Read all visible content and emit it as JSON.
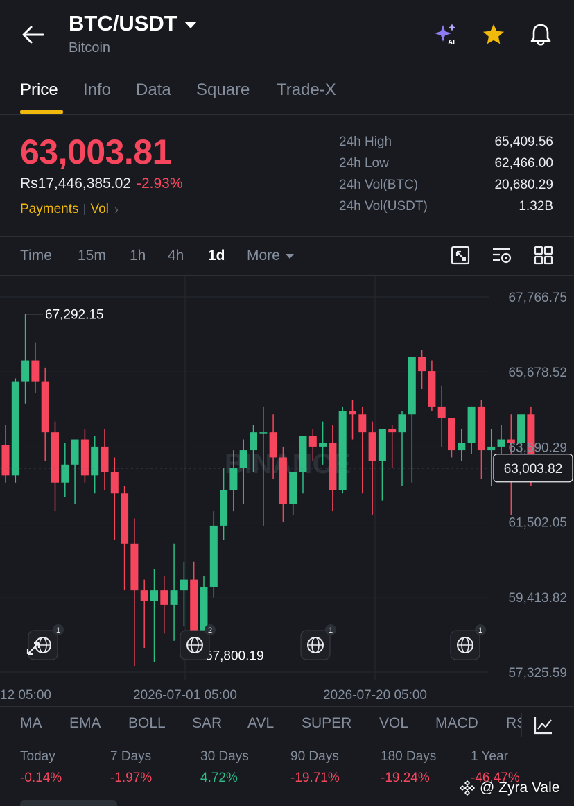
{
  "header": {
    "pair": "BTC/USDT",
    "name": "Bitcoin"
  },
  "tabs": [
    "Price",
    "Info",
    "Data",
    "Square",
    "Trade-X"
  ],
  "active_tab": "Price",
  "price": {
    "last": "63,003.81",
    "local": "Rs17,446,385.02",
    "change": "-2.93%",
    "tag_payments": "Payments",
    "tag_vol": "Vol"
  },
  "stats": [
    {
      "label": "24h High",
      "value": "65,409.56"
    },
    {
      "label": "24h Low",
      "value": "62,466.00"
    },
    {
      "label": "24h Vol(BTC)",
      "value": "20,680.29"
    },
    {
      "label": "24h Vol(USDT)",
      "value": "1.32B"
    }
  ],
  "timeframes": [
    "Time",
    "15m",
    "1h",
    "4h",
    "1d"
  ],
  "active_timeframe": "1d",
  "more_label": "More",
  "indicators": [
    "MA",
    "EMA",
    "BOLL",
    "SAR",
    "AVL",
    "SUPER",
    "VOL",
    "MACD",
    "RSI"
  ],
  "performance": [
    {
      "label": "Today",
      "value": "-0.14%"
    },
    {
      "label": "7 Days",
      "value": "-1.97%"
    },
    {
      "label": "30 Days",
      "value": "4.72%"
    },
    {
      "label": "90 Days",
      "value": "-19.71%"
    },
    {
      "label": "180 Days",
      "value": "-19.24%"
    },
    {
      "label": "1 Year",
      "value": "-46.47%"
    }
  ],
  "watermark": "@ Zyra Vale",
  "colors": {
    "up": "#2ebd85",
    "down": "#f6465d",
    "accent": "#f0b90b",
    "bg": "#181a20"
  },
  "chart_data": {
    "type": "candlestick",
    "watermark": "BINANCE",
    "y_ticks": [
      "67,766.75",
      "65,678.52",
      "63,590.29",
      "61,502.05",
      "59,413.82",
      "57,325.59"
    ],
    "x_ticks": [
      "12 05:00",
      "2026-07-01 05:00",
      "2026-07-20 05:00"
    ],
    "ylim": [
      57325.59,
      67766.75
    ],
    "current_price": "63,003.82",
    "high_marker": "67,292.15",
    "low_marker": "57,800.19",
    "event_badges": [
      "1",
      "2",
      "1",
      "1"
    ],
    "candles": [
      [
        63650,
        64200,
        62600,
        62800
      ],
      [
        62800,
        65500,
        62600,
        65400
      ],
      [
        65400,
        67300,
        64800,
        66000
      ],
      [
        66000,
        66500,
        65100,
        65400
      ],
      [
        65400,
        65800,
        63200,
        64000
      ],
      [
        64000,
        64300,
        61800,
        62600
      ],
      [
        62600,
        63700,
        62200,
        63100
      ],
      [
        63100,
        63600,
        62000,
        63800
      ],
      [
        63800,
        64100,
        62600,
        62800
      ],
      [
        62800,
        63900,
        62300,
        63600
      ],
      [
        63600,
        64100,
        62400,
        62900
      ],
      [
        62900,
        63300,
        61000,
        62300
      ],
      [
        62300,
        62500,
        59600,
        60900
      ],
      [
        60900,
        61600,
        57500,
        59600
      ],
      [
        59600,
        59900,
        58000,
        59300
      ],
      [
        59300,
        60200,
        57600,
        59600
      ],
      [
        59600,
        60000,
        58400,
        59200
      ],
      [
        59200,
        60900,
        58200,
        59600
      ],
      [
        59600,
        60400,
        58600,
        59900
      ],
      [
        59900,
        60400,
        57800,
        58300
      ],
      [
        58300,
        60000,
        57900,
        59700
      ],
      [
        59700,
        61800,
        59400,
        61400
      ],
      [
        61400,
        63000,
        61000,
        62400
      ],
      [
        62400,
        63500,
        61800,
        63000
      ],
      [
        63000,
        63800,
        62000,
        63500
      ],
      [
        63500,
        64200,
        62900,
        64000
      ],
      [
        64000,
        64700,
        61400,
        64000
      ],
      [
        64000,
        64500,
        62700,
        63300
      ],
      [
        63300,
        63600,
        61500,
        62000
      ],
      [
        62000,
        62800,
        61700,
        62900
      ],
      [
        62900,
        63800,
        62300,
        63900
      ],
      [
        63900,
        64100,
        63200,
        63600
      ],
      [
        63600,
        64300,
        63100,
        63700
      ],
      [
        63700,
        64200,
        61800,
        62400
      ],
      [
        62400,
        64700,
        62300,
        64600
      ],
      [
        64600,
        64900,
        63800,
        64500
      ],
      [
        64500,
        64700,
        62300,
        64000
      ],
      [
        64000,
        64300,
        61700,
        63200
      ],
      [
        63200,
        64100,
        62100,
        64100
      ],
      [
        64100,
        64200,
        63000,
        64000
      ],
      [
        64000,
        64600,
        62500,
        64500
      ],
      [
        64500,
        66100,
        62600,
        66100
      ],
      [
        66100,
        66300,
        65200,
        65700
      ],
      [
        65700,
        66000,
        64600,
        64700
      ],
      [
        64700,
        65300,
        63600,
        64400
      ],
      [
        64400,
        64300,
        63300,
        63500
      ],
      [
        63500,
        64100,
        63200,
        63700
      ],
      [
        63700,
        64700,
        63400,
        64700
      ],
      [
        64700,
        64900,
        62700,
        63500
      ],
      [
        63500,
        64100,
        62500,
        63600
      ],
      [
        63600,
        64200,
        62700,
        63800
      ],
      [
        63800,
        64500,
        61700,
        63700
      ],
      [
        63700,
        64500,
        63300,
        64500
      ],
      [
        64500,
        64700,
        62500,
        63000
      ]
    ]
  }
}
